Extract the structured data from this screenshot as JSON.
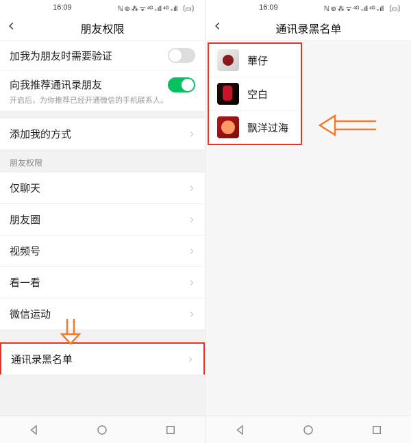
{
  "statusbar": {
    "time": "16:09",
    "icons_text": "ℕ ⊚ ⁂ ᯤ ⁴ᴳ ₊ıll ⁴ᴳ ₊ıll 〔▭〕"
  },
  "left": {
    "title": "朋友权限",
    "row_verify": "加我为朋友时需要验证",
    "row_reco": {
      "label": "向我推荐通讯录朋友",
      "sub": "开启后，为你推荐已经开通微信的手机联系人。"
    },
    "row_add_method": "添加我的方式",
    "section_friends": "朋友权限",
    "row_chat_only": "仅聊天",
    "row_moments": "朋友圈",
    "row_channels": "视频号",
    "row_kanykan": "看一看",
    "row_werun": "微信运动",
    "row_blacklist": "通讯录黑名单"
  },
  "right": {
    "title": "通讯录黑名单",
    "contacts": [
      {
        "name": "華仔"
      },
      {
        "name": "空白"
      },
      {
        "name": "飘洋过海"
      }
    ]
  },
  "colors": {
    "highlight": "#e83323",
    "arrow": "#f17b2b",
    "toggle_on": "#07c160"
  }
}
